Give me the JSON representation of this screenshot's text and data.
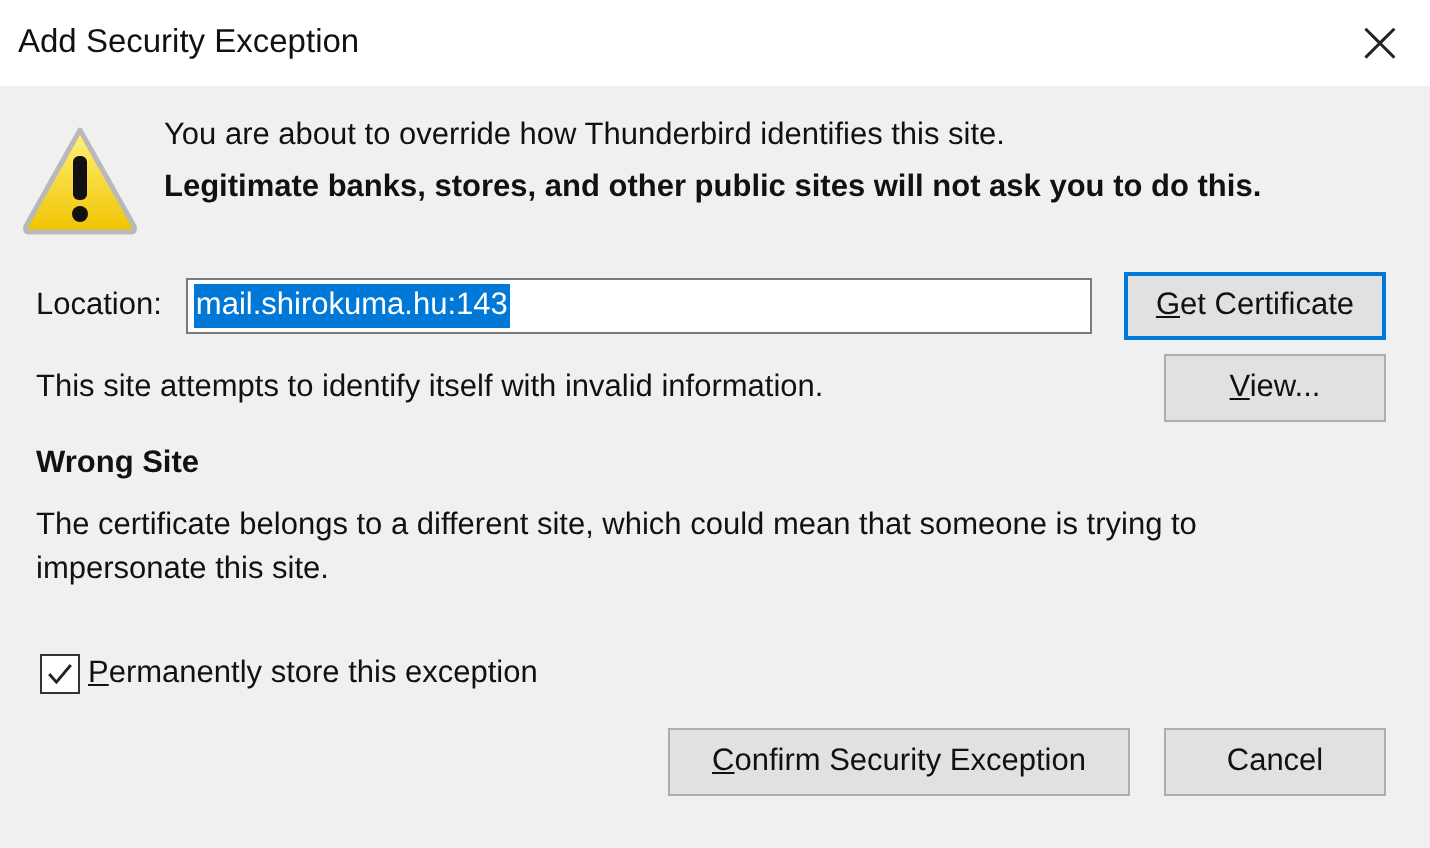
{
  "window": {
    "title": "Add Security Exception",
    "close": "×"
  },
  "warning": {
    "text": "You are about to override how Thunderbird identifies this site.",
    "bold_text": "Legitimate banks, stores, and other public sites will not ask you to do this."
  },
  "location": {
    "label": "Location:",
    "value": "mail.shirokuma.hu:143",
    "value_selected": true,
    "button": {
      "label": "Get Certificate",
      "access_key_underlined": true,
      "focused": true
    }
  },
  "status": {
    "text": "This site attempts to identify itself with invalid information.",
    "button": {
      "label": "View...",
      "access_key_underlined": true,
      "focused": false
    }
  },
  "problem": {
    "title": "Wrong Site",
    "text": "The certificate belongs to a different site, which could mean that someone is trying to impersonate this site."
  },
  "permanent": {
    "label": "Permanently store this exception",
    "access_key_underlined": true,
    "checked": true
  },
  "buttons": [
    {
      "label": "Confirm Security Exception",
      "access_key_underlined": true,
      "focused": false
    },
    {
      "label": "Cancel",
      "access_key_underlined": false,
      "focused": false
    }
  ]
}
